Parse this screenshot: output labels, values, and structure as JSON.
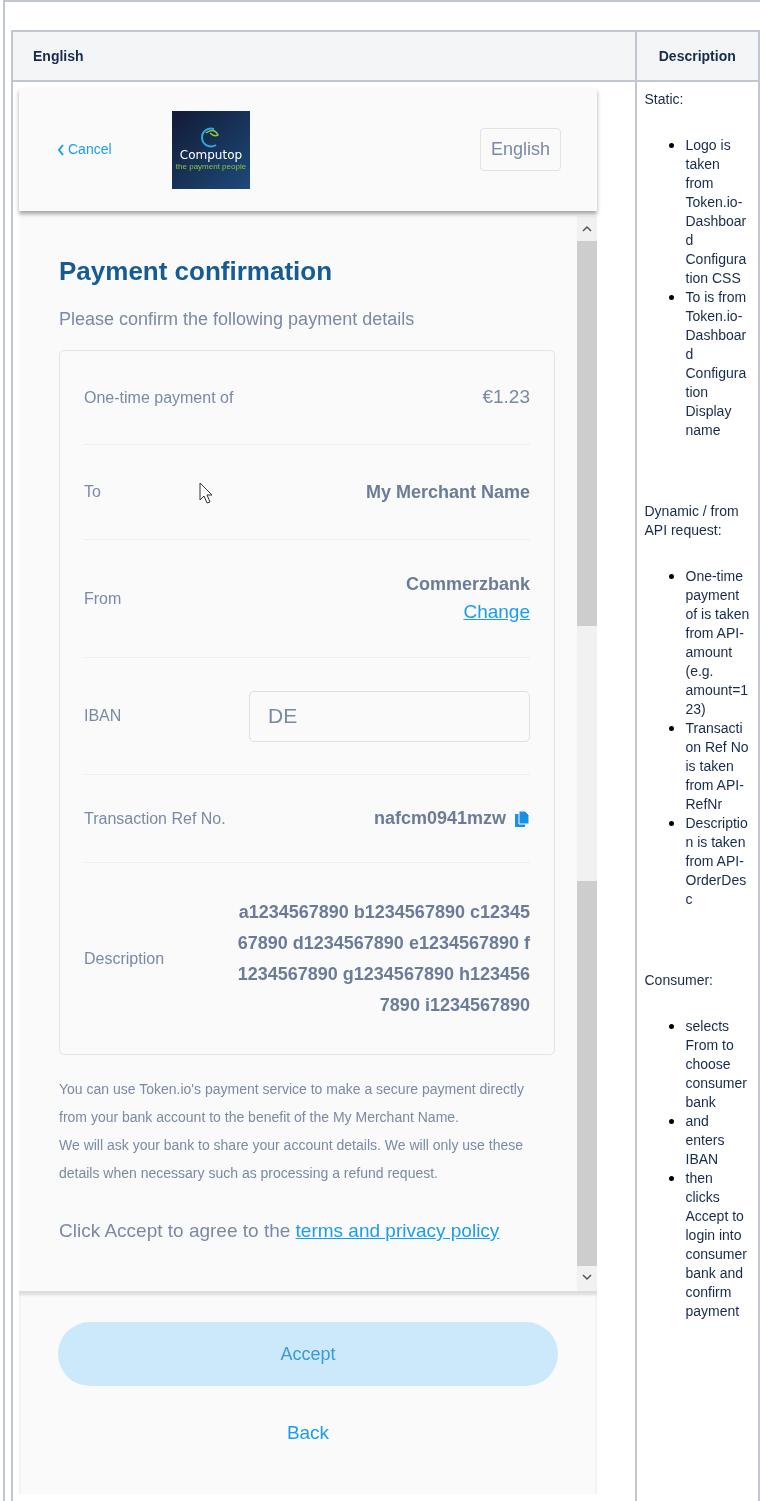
{
  "table": {
    "columns": [
      "English",
      "Description"
    ]
  },
  "phone": {
    "header": {
      "cancel": "Cancel",
      "logo": {
        "name": "Computop",
        "tagline": "the payment people"
      },
      "language": "English"
    },
    "title": "Payment confirmation",
    "subtitle": "Please confirm the following payment details",
    "details": [
      {
        "kind": "amount",
        "label": "One-time payment of",
        "value": "€1.23"
      },
      {
        "kind": "bold",
        "label": "To",
        "value": "My Merchant Name"
      },
      {
        "kind": "bank",
        "label": "From",
        "value": "Commerzbank",
        "link": "Change"
      },
      {
        "kind": "input",
        "label": "IBAN",
        "value": "DE"
      },
      {
        "kind": "copy",
        "label": "Transaction Ref No.",
        "value": "nafcm0941mzw"
      },
      {
        "kind": "multiline",
        "label": "Description",
        "value": "a1234567890 b1234567890 c1234567890 d1234567890 e1234567890 f1234567890 g1234567890 h1234567890 i1234567890"
      }
    ],
    "notice": [
      "You can use Token.io's payment service to make a secure payment directly from your bank account to the benefit of the My Merchant Name.",
      "We will ask your bank to share your account details. We will only use these details when necessary such as processing a refund request."
    ],
    "consent": {
      "text": "Click Accept to agree to the",
      "link": "terms and privacy policy"
    },
    "accept": {
      "label": "Accept",
      "disabled": true
    },
    "back": "Back"
  },
  "description": {
    "sections": [
      {
        "heading": "Static:",
        "items": [
          "Logo is taken from Token.io-Dashboard Configuration CSS",
          "To is from Token.io-Dashboard Configuration Display name"
        ]
      },
      {
        "heading": "Dynamic / from API request:",
        "items": [
          "One-time payment of is taken from API-amount (e.g. amount=123)",
          "Transaction Ref No is taken from API-RefNr",
          "Description is taken from API-OrderDesc"
        ]
      },
      {
        "heading": "Consumer:",
        "items": [
          "selects From to choose consumer bank",
          "and enters IBAN",
          "then clicks Accept to login into consumer bank and confirm payment"
        ]
      }
    ]
  }
}
